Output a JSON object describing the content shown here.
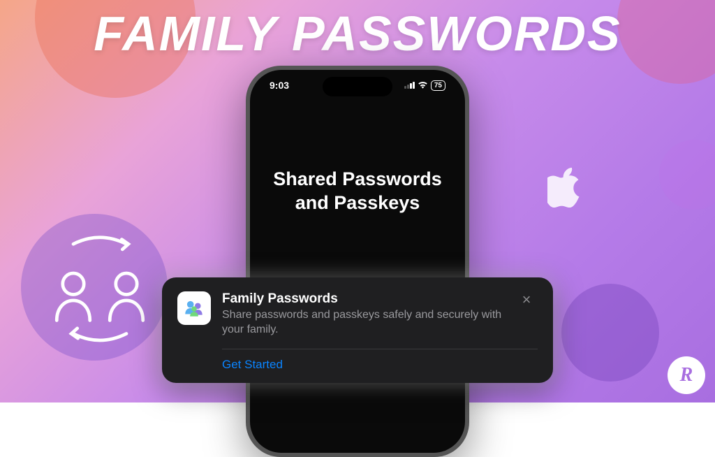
{
  "banner": {
    "title": "FAMILY PASSWORDS"
  },
  "statusbar": {
    "time": "9:03",
    "battery": "75"
  },
  "phone_screen": {
    "heading": "Shared Passwords and Passkeys"
  },
  "card": {
    "icon_name": "family-people-icon",
    "title": "Family Passwords",
    "description": "Share passwords and passkeys safely and securely with your family.",
    "action_label": "Get Started",
    "close_label": "×"
  },
  "brand": {
    "initials": "R"
  },
  "colors": {
    "accent_blue": "#0a84ff",
    "card_bg": "#1f1f21",
    "muted_text": "#9a9a9e"
  }
}
